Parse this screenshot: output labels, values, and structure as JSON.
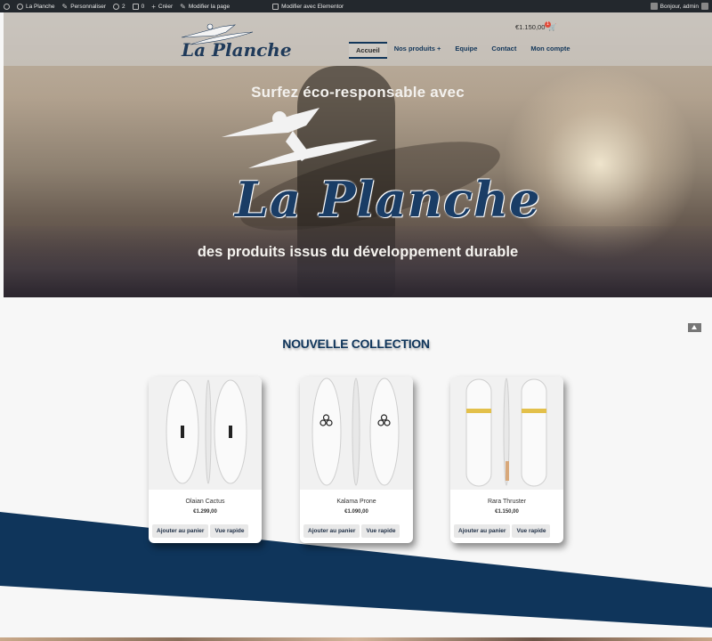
{
  "adminbar": {
    "site": "La Planche",
    "customize": "Personnaliser",
    "updates_count": "2",
    "comments_count": "0",
    "create": "Créer",
    "edit_page": "Modifier la page",
    "elementor": "Modifier avec Elementor",
    "greeting": "Bonjour, admin"
  },
  "header": {
    "logo_text": "La Planche",
    "menu": [
      "Accueil",
      "Nos produits  +",
      "Equipe",
      "Contact",
      "Mon compte"
    ],
    "cart_total": "€1.150,00",
    "cart_count": "1"
  },
  "hero": {
    "line1": "Surfez éco-responsable avec",
    "brand": "La Planche",
    "line2": "des produits issus du développement durable"
  },
  "section": {
    "title": "NOUVELLE COLLECTION"
  },
  "products": [
    {
      "name": "Olaian Cactus",
      "price": "€1.299,00",
      "add_label": "Ajouter au panier",
      "quick_label": "Vue rapide",
      "stripe": "none"
    },
    {
      "name": "Kalama Prone",
      "price": "€1.090,00",
      "add_label": "Ajouter au panier",
      "quick_label": "Vue rapide",
      "stripe": "none"
    },
    {
      "name": "Rara Thruster",
      "price": "€1.150,00",
      "add_label": "Ajouter au panier",
      "quick_label": "Vue rapide",
      "stripe": "yellow"
    }
  ],
  "colors": {
    "navy": "#0f355b",
    "adminbar": "#23282d",
    "badge": "#e14b3a"
  }
}
